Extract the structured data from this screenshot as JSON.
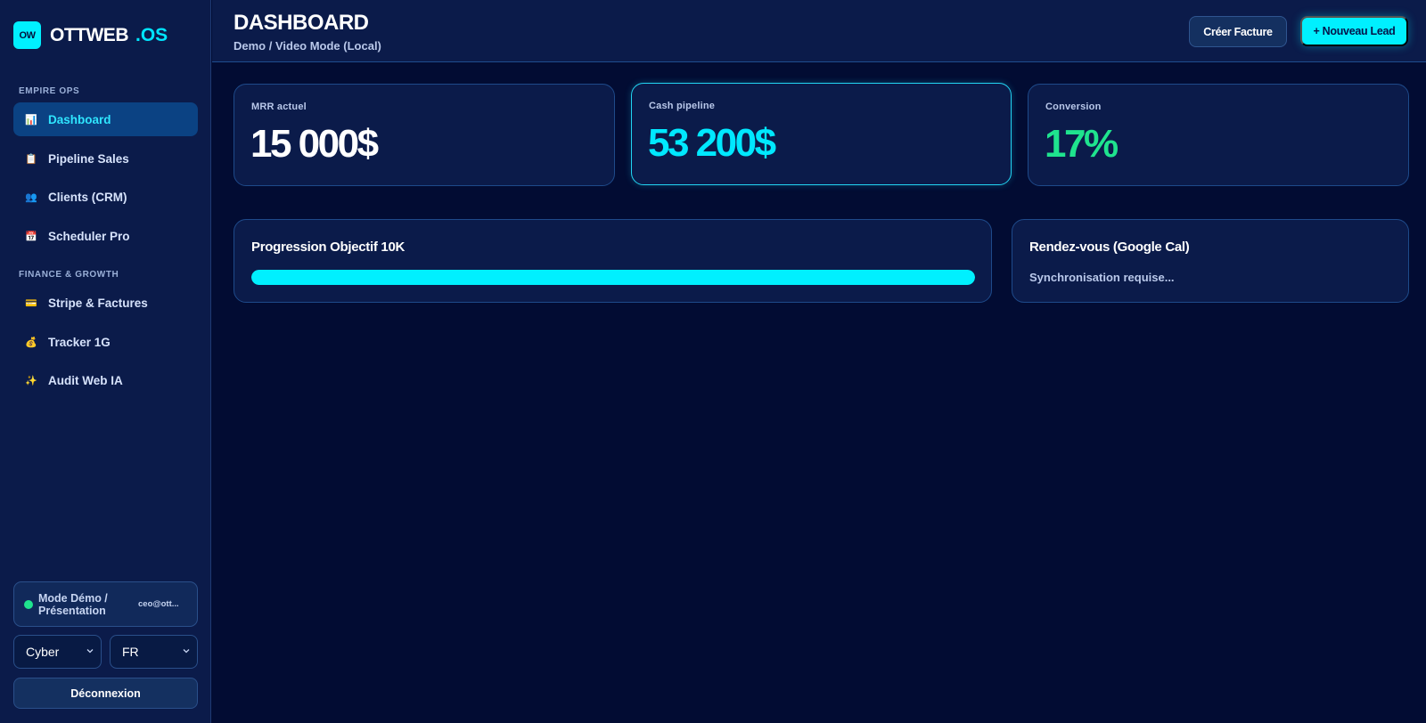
{
  "brand": {
    "logo": "OW",
    "name": "OTTWEB",
    "suffix": ".OS"
  },
  "sidebar": {
    "sections": [
      {
        "label": "EMPIRE OPS"
      },
      {
        "label": "FINANCE & GROWTH"
      }
    ],
    "items": [
      {
        "label": "Dashboard",
        "icon": "📊",
        "icon_name": "chart-icon"
      },
      {
        "label": "Pipeline Sales",
        "icon": "📋",
        "icon_name": "clipboard-icon"
      },
      {
        "label": "Clients (CRM)",
        "icon": "👥",
        "icon_name": "users-icon"
      },
      {
        "label": "Scheduler Pro",
        "icon": "📅",
        "icon_name": "calendar-icon"
      },
      {
        "label": "Stripe & Factures",
        "icon": "💳",
        "icon_name": "credit-card-icon"
      },
      {
        "label": "Tracker 1G",
        "icon": "💰",
        "icon_name": "money-bag-icon"
      },
      {
        "label": "Audit Web IA",
        "icon": "✨",
        "icon_name": "sparkles-icon"
      }
    ],
    "demo": {
      "label": "Mode Démo / Présentation",
      "email": "ceo@ott..."
    },
    "theme_select": {
      "value": "Cyber"
    },
    "lang_select": {
      "value": "FR"
    },
    "logout_label": "Déconnexion"
  },
  "header": {
    "title": "DASHBOARD",
    "breadcrumb": "Demo / Video Mode (Local)",
    "secondary_button": "Créer Facture",
    "primary_button": "+ Nouveau Lead"
  },
  "stats": [
    {
      "label": "MRR actuel",
      "value": "15 000$",
      "color": "#ffffff"
    },
    {
      "label": "Cash pipeline",
      "value": "53 200$",
      "color": "#00e8ff"
    },
    {
      "label": "Conversion",
      "value": "17%",
      "color": "#1fe38e"
    }
  ],
  "progress": {
    "title": "Progression Objectif 10K",
    "percent": 100
  },
  "calendar": {
    "title": "Rendez-vous (Google Cal)",
    "status": "Synchronisation requise..."
  },
  "colors": {
    "accent": "#00f0ff",
    "success": "#1fe38e",
    "background": "#020c33",
    "panel": "#0b1b4a"
  }
}
